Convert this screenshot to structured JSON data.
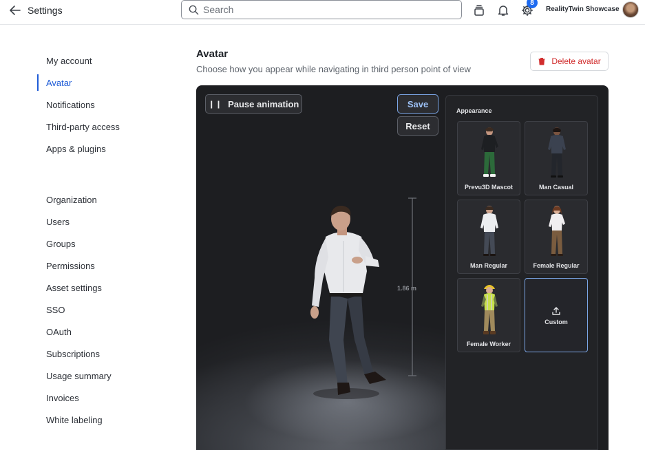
{
  "header": {
    "back_label": "Settings",
    "search_placeholder": "Search",
    "notification_badge": "8",
    "org_name": "RealityTwin Showcase"
  },
  "sidebar": {
    "account_items": [
      {
        "label": "My account"
      },
      {
        "label": "Avatar",
        "active": true
      },
      {
        "label": "Notifications"
      },
      {
        "label": "Third-party access"
      },
      {
        "label": "Apps & plugins"
      }
    ],
    "org_items": [
      {
        "label": "Organization"
      },
      {
        "label": "Users"
      },
      {
        "label": "Groups"
      },
      {
        "label": "Permissions"
      },
      {
        "label": "Asset settings"
      },
      {
        "label": "SSO"
      },
      {
        "label": "OAuth"
      },
      {
        "label": "Subscriptions"
      },
      {
        "label": "Usage summary"
      },
      {
        "label": "Invoices"
      },
      {
        "label": "White labeling"
      }
    ]
  },
  "main": {
    "title": "Avatar",
    "subtitle": "Choose how you appear while navigating in third person point of view",
    "delete_label": "Delete avatar"
  },
  "viewer": {
    "pause_label": "Pause animation",
    "save_label": "Save",
    "reset_label": "Reset",
    "height_label": "1.86 m"
  },
  "appearance": {
    "title": "Appearance",
    "options": [
      {
        "label": "Prevu3D Mascot"
      },
      {
        "label": "Man Casual"
      },
      {
        "label": "Man Regular"
      },
      {
        "label": "Female Regular"
      },
      {
        "label": "Female Worker"
      },
      {
        "label": "Custom",
        "selected": true
      }
    ]
  },
  "colors": {
    "accent": "#1e5bd6",
    "danger": "#d12d2d",
    "viewer_bg": "#1b1c1e",
    "panel_bg": "#222326"
  }
}
